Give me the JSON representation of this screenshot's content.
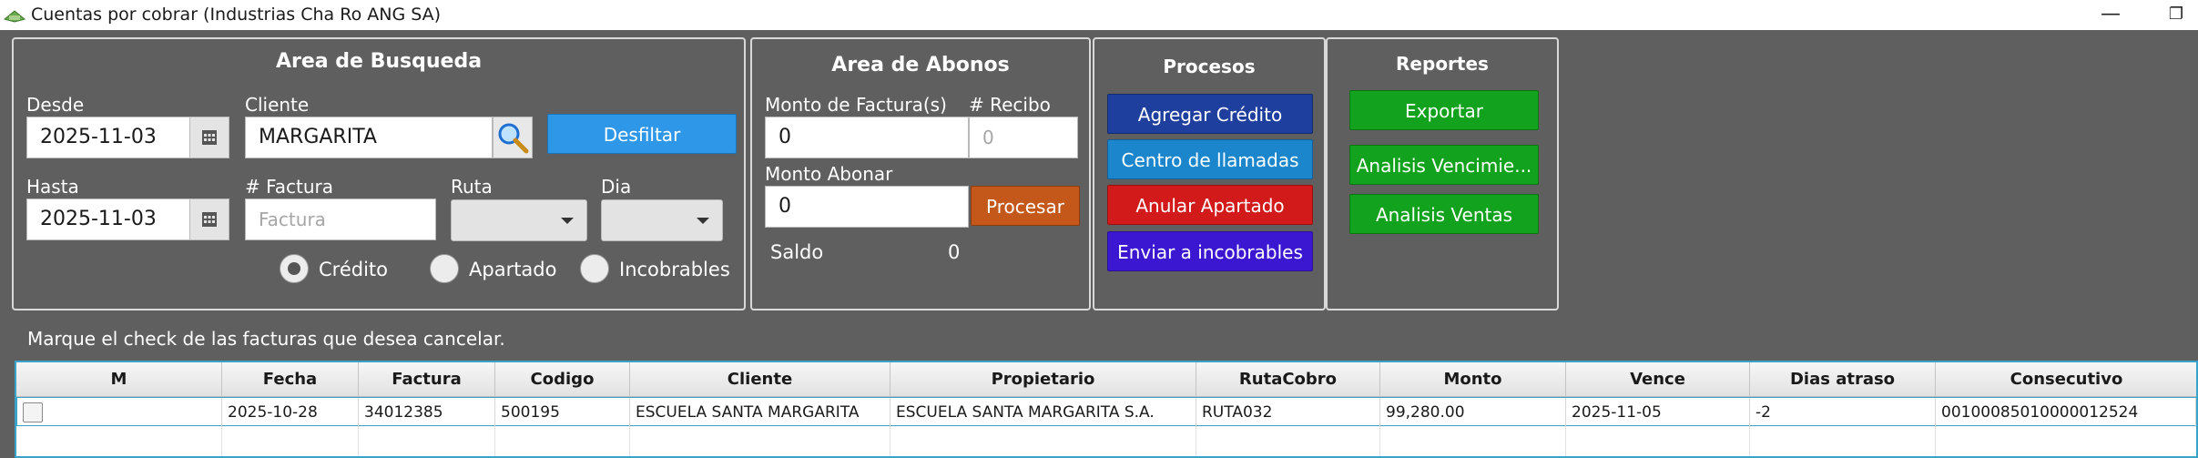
{
  "window": {
    "title": "Cuentas por cobrar (Industrias Cha Ro ANG SA)",
    "minimize_glyph": "—",
    "restore_glyph": "❐",
    "app_icon": "cash-icon"
  },
  "busqueda": {
    "title": "Area de Busqueda",
    "desde_label": "Desde",
    "desde_value": "2025-11-03",
    "cliente_label": "Cliente",
    "cliente_value": "MARGARITA",
    "desfiltar_label": "Desfiltar",
    "hasta_label": "Hasta",
    "hasta_value": "2025-11-03",
    "factura_label": "# Factura",
    "factura_placeholder": "Factura",
    "ruta_label": "Ruta",
    "dia_label": "Dia",
    "radios": [
      {
        "label": "Crédito",
        "selected": true
      },
      {
        "label": "Apartado",
        "selected": false
      },
      {
        "label": "Incobrables",
        "selected": false
      }
    ]
  },
  "abonos": {
    "title": "Area de Abonos",
    "monto_factura_label": "Monto de Factura(s)",
    "monto_factura_value": "0",
    "recibo_label": "# Recibo",
    "recibo_placeholder": "0",
    "monto_abonar_label": "Monto Abonar",
    "monto_abonar_value": "0",
    "procesar_label": "Procesar",
    "saldo_label": "Saldo",
    "saldo_value": "0"
  },
  "procesos": {
    "title": "Procesos",
    "buttons": [
      {
        "label": "Agregar Crédito",
        "color": "#1f3f9e"
      },
      {
        "label": "Centro de llamadas",
        "color": "#1b86cc"
      },
      {
        "label": "Anular Apartado",
        "color": "#d21a1a"
      },
      {
        "label": "Enviar a incobrables",
        "color": "#3b17d1"
      }
    ]
  },
  "reportes": {
    "title": "Reportes",
    "buttons": [
      {
        "label": "Exportar",
        "color": "#13a21d"
      },
      {
        "label": "Analisis Vencimie...",
        "color": "#13a21d"
      },
      {
        "label": "Analisis Ventas",
        "color": "#13a21d"
      }
    ]
  },
  "instruction": "Marque el check de las facturas que desea cancelar.",
  "table": {
    "columns": [
      "M",
      "Fecha",
      "Factura",
      "Codigo",
      "Cliente",
      "Propietario",
      "RutaCobro",
      "Monto",
      "Vence",
      "Dias atraso",
      "Consecutivo"
    ],
    "rows": [
      [
        "",
        "2025-10-28",
        "34012385",
        "500195",
        "ESCUELA SANTA MARGARITA",
        "ESCUELA SANTA MARGARITA S.A.",
        "RUTA032",
        "99,280.00",
        "2025-11-05",
        "-2",
        "00100085010000012524"
      ]
    ]
  }
}
